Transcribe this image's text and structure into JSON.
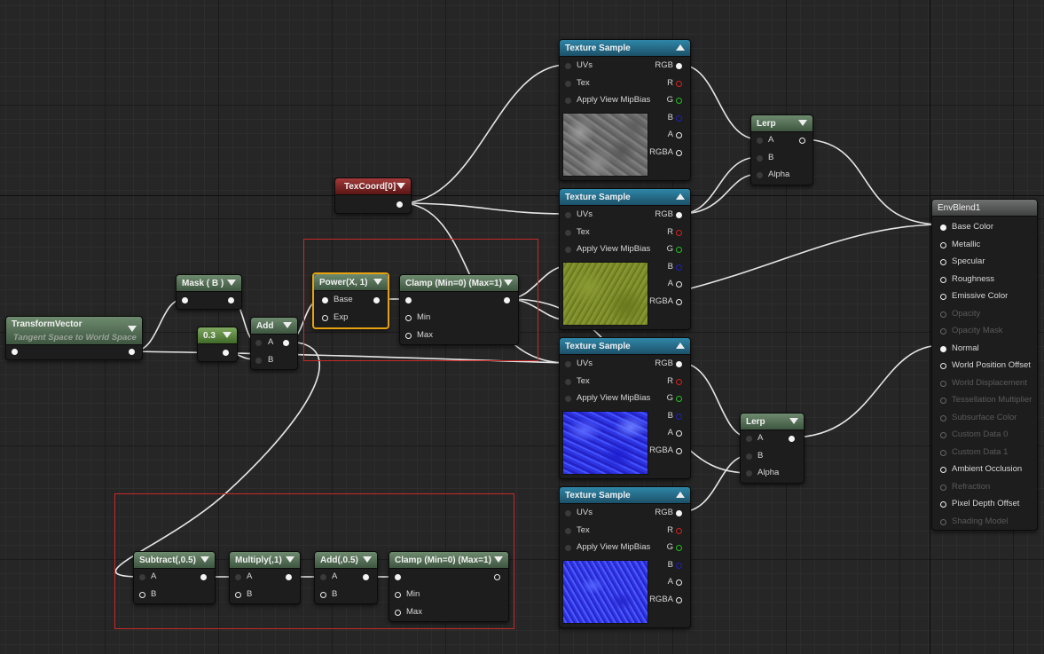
{
  "graph": {
    "nodes": {
      "transform_vector": {
        "title": "TransformVector",
        "subtitle": "Tangent Space to World Space"
      },
      "mask": {
        "title": "Mask ( B )"
      },
      "const": {
        "title": "0.3"
      },
      "add": {
        "title": "Add",
        "pins": [
          "A",
          "B"
        ]
      },
      "power": {
        "title": "Power(X, 1)",
        "pins": [
          "Base",
          "Exp"
        ]
      },
      "clamp_top": {
        "title": "Clamp (Min=0) (Max=1)",
        "pins": [
          "Min",
          "Max"
        ]
      },
      "texcoord": {
        "title": "TexCoord[0]"
      },
      "texture_samples": [
        {
          "title": "Texture Sample",
          "texture": "rock"
        },
        {
          "title": "Texture Sample",
          "texture": "grass"
        },
        {
          "title": "Texture Sample",
          "texture": "normal"
        },
        {
          "title": "Texture Sample",
          "texture": "normal-fine"
        }
      ],
      "texture_sample_inputs": [
        "UVs",
        "Tex",
        "Apply View MipBias"
      ],
      "texture_sample_outputs": [
        "RGB",
        "R",
        "G",
        "B",
        "A",
        "RGBA"
      ],
      "lerp_top": {
        "title": "Lerp",
        "pins": [
          "A",
          "B",
          "Alpha"
        ]
      },
      "lerp_bottom": {
        "title": "Lerp",
        "pins": [
          "A",
          "B",
          "Alpha"
        ]
      },
      "subtract": {
        "title": "Subtract(,0.5)",
        "pins": [
          "A",
          "B"
        ]
      },
      "multiply": {
        "title": "Multiply(,1)",
        "pins": [
          "A",
          "B"
        ]
      },
      "add_half": {
        "title": "Add(,0.5)",
        "pins": [
          "A",
          "B"
        ]
      },
      "clamp_bottom": {
        "title": "Clamp (Min=0) (Max=1)",
        "pins": [
          "Min",
          "Max"
        ]
      }
    },
    "material": {
      "title": "EnvBlend1",
      "inputs": [
        {
          "label": "Base Color",
          "enabled": true,
          "connected": true
        },
        {
          "label": "Metallic",
          "enabled": true,
          "connected": false
        },
        {
          "label": "Specular",
          "enabled": true,
          "connected": false
        },
        {
          "label": "Roughness",
          "enabled": true,
          "connected": false
        },
        {
          "label": "Emissive Color",
          "enabled": true,
          "connected": false
        },
        {
          "label": "Opacity",
          "enabled": false,
          "connected": false
        },
        {
          "label": "Opacity Mask",
          "enabled": false,
          "connected": false
        },
        {
          "label": "Normal",
          "enabled": true,
          "connected": true
        },
        {
          "label": "World Position Offset",
          "enabled": true,
          "connected": false
        },
        {
          "label": "World Displacement",
          "enabled": false,
          "connected": false
        },
        {
          "label": "Tessellation Multiplier",
          "enabled": false,
          "connected": false
        },
        {
          "label": "Subsurface Color",
          "enabled": false,
          "connected": false
        },
        {
          "label": "Custom Data 0",
          "enabled": false,
          "connected": false
        },
        {
          "label": "Custom Data 1",
          "enabled": false,
          "connected": false
        },
        {
          "label": "Ambient Occlusion",
          "enabled": true,
          "connected": false
        },
        {
          "label": "Refraction",
          "enabled": false,
          "connected": false
        },
        {
          "label": "Pixel Depth Offset",
          "enabled": true,
          "connected": false
        },
        {
          "label": "Shading Model",
          "enabled": false,
          "connected": false
        }
      ]
    },
    "colors": {
      "grid_bg": "#262626",
      "wire": "#e6e6e6",
      "selection_box": "#c62a2a",
      "selected_node": "#e8a20f"
    }
  }
}
